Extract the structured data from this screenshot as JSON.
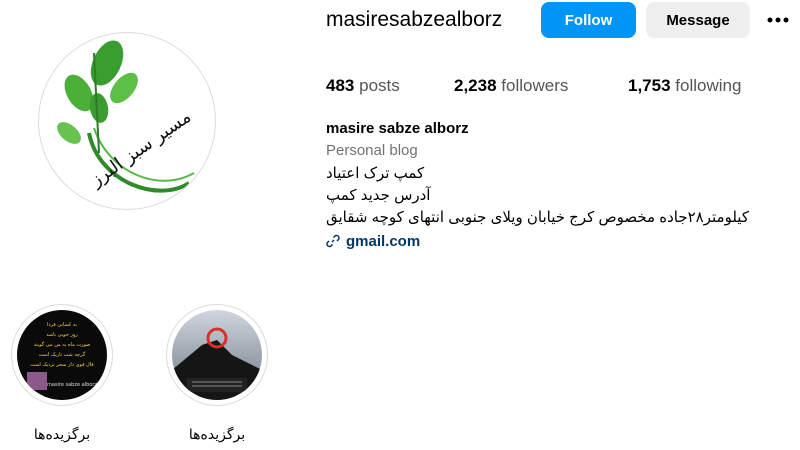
{
  "profile": {
    "username": "masiresabzealborz",
    "follow_label": "Follow",
    "message_label": "Message",
    "more_icon": "more-horizontal-icon"
  },
  "stats": {
    "posts_count": "483",
    "posts_label": "posts",
    "followers_count": "2,238",
    "followers_label": "followers",
    "following_count": "1,753",
    "following_label": "following"
  },
  "bio": {
    "full_name": "masire sabze alborz",
    "category": "Personal blog",
    "lines": [
      "کمپ ترک اعتیاد",
      "آدرس جدید کمپ",
      "کیلومتر۲۸جاده مخصوص کرج خیابان ویلای جنوبی انتهای کوچه شقایق"
    ],
    "link_text": "gmail.com"
  },
  "avatar_logo_text": "مسیر سبز البرز",
  "highlights": [
    {
      "label": "برگزیده‌ها",
      "thumb_text_lines": [
        "به کسانی فردا",
        "روز خوبی باشد",
        "صورت ماه به من می گویند",
        "گرچه شب تاریک است",
        "فال قوی دار سحر نزدیک است",
        "masire sabze alborz"
      ]
    },
    {
      "label": "برگزیده‌ها"
    }
  ],
  "colors": {
    "follow_bg": "#0095f6",
    "message_bg": "#efefef",
    "link": "#00376b",
    "muted": "#737373",
    "leaf_green": "#3a9d2f"
  }
}
